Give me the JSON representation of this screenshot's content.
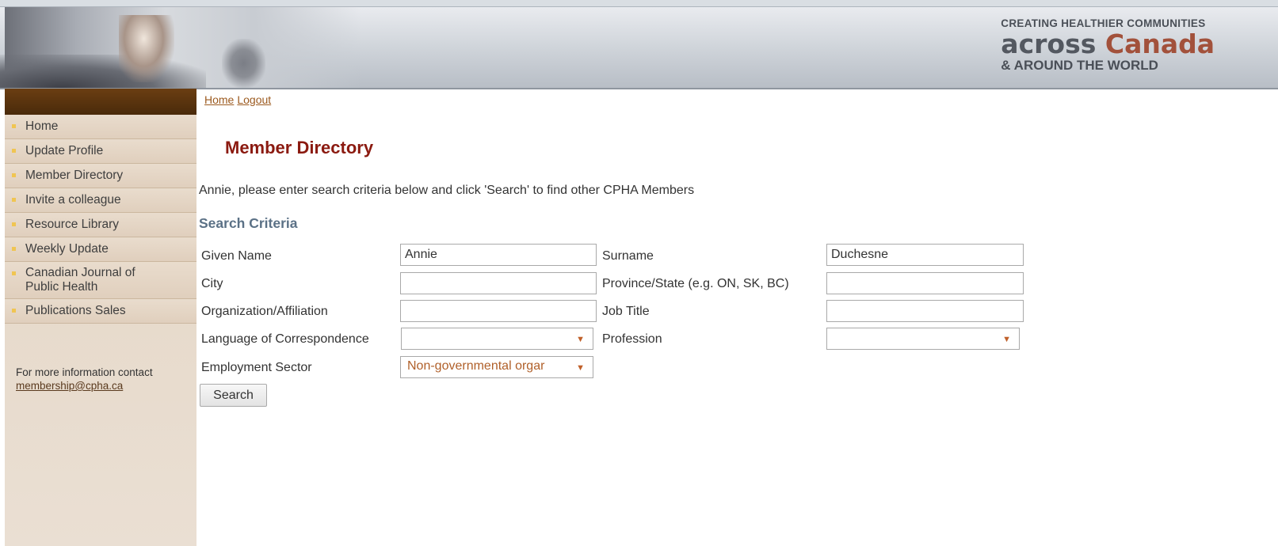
{
  "banner": {
    "tagline_line1": "CREATING HEALTHIER COMMUNITIES",
    "tagline_across": "across",
    "tagline_canada": "Canada",
    "tagline_line3": "& AROUND THE WORLD"
  },
  "breadcrumb": {
    "home": "Home",
    "logout": "Logout"
  },
  "sidebar": {
    "items": [
      {
        "label": "Home"
      },
      {
        "label": "Update Profile"
      },
      {
        "label": "Member Directory"
      },
      {
        "label": "Invite a colleague"
      },
      {
        "label": "Resource Library"
      },
      {
        "label": "Weekly Update"
      },
      {
        "label_line1": "Canadian Journal of",
        "label_line2": "Public Health"
      },
      {
        "label": "Publications Sales"
      }
    ],
    "info_text": "For more information contact",
    "info_email": "membership@cpha.ca"
  },
  "main": {
    "title": "Member Directory",
    "intro": "Annie, please enter search criteria below and click 'Search' to find other CPHA Members",
    "section_title": "Search Criteria",
    "fields": {
      "given_name": {
        "label": "Given Name",
        "value": "Annie"
      },
      "surname": {
        "label": "Surname",
        "value": "Duchesne"
      },
      "city": {
        "label": "City",
        "value": ""
      },
      "province": {
        "label": "Province/State (e.g. ON, SK, BC)",
        "value": ""
      },
      "organization": {
        "label": "Organization/Affiliation",
        "value": ""
      },
      "job_title": {
        "label": "Job Title",
        "value": ""
      },
      "language": {
        "label": "Language of Correspondence",
        "value": ""
      },
      "profession": {
        "label": "Profession",
        "value": ""
      },
      "sector": {
        "label": "Employment Sector",
        "value": "Non-governmental orgar"
      }
    },
    "search_button": "Search"
  },
  "colors": {
    "title": "#8b1a10",
    "section_title": "#5b7186",
    "link": "#9c5a1f",
    "sidebar_header": "#5a3310",
    "sidebar_bg": "#e4d6c5",
    "bullet": "#f0c552"
  },
  "icons": {
    "dropdown": "caret-down-icon",
    "nav_bullet": "square-bullet-icon"
  }
}
